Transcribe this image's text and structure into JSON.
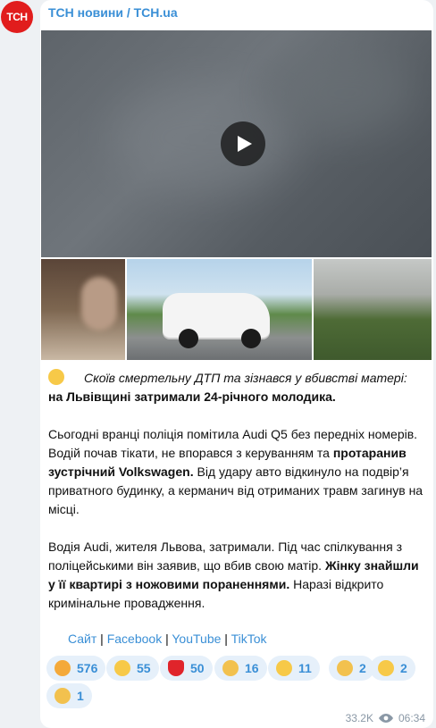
{
  "channel": {
    "avatar_text": "ТСН",
    "name": "ТСН новини / TCH.ua"
  },
  "post": {
    "lead_italic": "Скоїв смертельну ДТП та зізнався у вбивстві матері:",
    "lead_bold": "на Львівщині затримали 24-річного молодика.",
    "p2_a": "Сьогодні вранці поліція помітила Audi Q5 без передніх номерів. Водій почав тікати, не впорався з керуванням та ",
    "p2_b": "протаранив зустрічний Volkswagen.",
    "p2_c": " Від удару авто відкинуло на подвір’я приватного будинку, а кермaнич від отриманих травм загинув на місці.",
    "p3_a": "Водія Audi, жителя Львова, затримали. Під час спілкування з поліцейськими він заявив, що вбив свою матір. ",
    "p3_b": "Жінку знайшли у її квартирі з ножовими пораненнями.",
    "p3_c": " Наразі відкрито кримінальне провадження."
  },
  "links": {
    "site": "Сайт",
    "sep": " | ",
    "facebook": "Facebook",
    "youtube": "YouTube",
    "tiktok": "TikTok"
  },
  "reactions": [
    {
      "emoji": "angry-face-emoji",
      "count": "576",
      "color": "#f4a93a"
    },
    {
      "emoji": "screaming-face-emoji",
      "count": "55",
      "color": "#f7c948"
    },
    {
      "emoji": "heart-emoji",
      "count": "50",
      "color": "#e0242b"
    },
    {
      "emoji": "folded-hands-emoji",
      "count": "16",
      "color": "#f2c14e"
    },
    {
      "emoji": "crying-face-emoji",
      "count": "11",
      "color": "#f7c948"
    },
    {
      "emoji": "clapping-hands-emoji",
      "count": "2",
      "color": "#f2c14e"
    },
    {
      "emoji": "star-struck-emoji",
      "count": "2",
      "color": "#f7c948"
    },
    {
      "emoji": "thumbs-up-emoji",
      "count": "1",
      "color": "#f2c14e"
    }
  ],
  "meta": {
    "views": "33.2K",
    "time": "06:34"
  },
  "colors": {
    "accent": "#3a8fd6",
    "avatar_bg": "#e11d1d",
    "reaction_bg": "#e6f0fa"
  }
}
